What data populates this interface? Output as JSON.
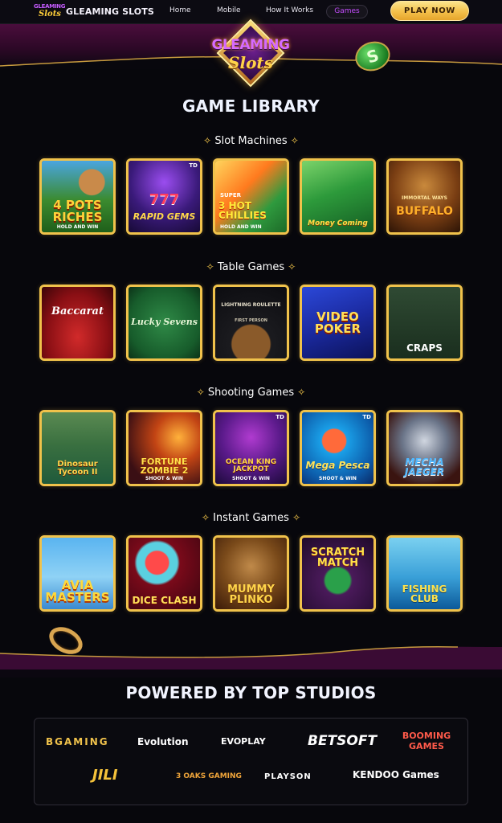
{
  "nav": {
    "brand_logo_top": "GLEAMING",
    "brand_logo_bottom": "Slots",
    "brand_name": "GLEAMING SLOTS",
    "links": [
      "Home",
      "Mobile",
      "How It Works",
      "Games"
    ],
    "active": "Games",
    "play_now": "PLAY NOW"
  },
  "hero": {
    "logo_top": "GLEAMING",
    "logo_bottom": "Slots",
    "coin_symbol": "S"
  },
  "library_title": "GAME LIBRARY",
  "categories": [
    {
      "title": "Slot Machines",
      "games": [
        {
          "label": "4 POTS RICHES",
          "sub": "HOLD AND WIN"
        },
        {
          "label": "RAPID GEMS",
          "top": "777",
          "badge": "TD"
        },
        {
          "label": "3 HOT CHILLIES",
          "top": "SUPER",
          "sub": "HOLD AND WIN"
        },
        {
          "label": "Money Coming"
        },
        {
          "label": "BUFFALO",
          "top": "IMMORTAL WAYS"
        }
      ]
    },
    {
      "title": "Table Games",
      "games": [
        {
          "label": "Baccarat"
        },
        {
          "label": "Lucky Sevens"
        },
        {
          "label": "LIGHTNING ROULETTE",
          "sub": "FIRST PERSON"
        },
        {
          "label": "VIDEO POKER"
        },
        {
          "label": "CRAPS"
        }
      ]
    },
    {
      "title": "Shooting Games",
      "games": [
        {
          "label": "Dinosaur Tycoon II"
        },
        {
          "label": "FORTUNE ZOMBIE 2",
          "sub": "SHOOT & WIN"
        },
        {
          "label": "OCEAN KING JACKPOT",
          "sub": "SHOOT & WIN",
          "badge": "TD"
        },
        {
          "label": "Mega Pesca",
          "sub": "SHOOT & WIN",
          "badge": "TD"
        },
        {
          "label": "MECHA JAEGER"
        }
      ]
    },
    {
      "title": "Instant Games",
      "games": [
        {
          "label": "AVIA MASTERS"
        },
        {
          "label": "DICE CLASH"
        },
        {
          "label": "MUMMY PLINKO"
        },
        {
          "label": "SCRATCH MATCH"
        },
        {
          "label": "FISHING CLUB"
        }
      ]
    }
  ],
  "studios_title": "POWERED BY TOP STUDIOS",
  "studios": [
    "BGAMING",
    "Evolution",
    "EVOPLAY",
    "BETSOFT",
    "BOOMING GAMES",
    "JILI",
    "3 OAKS GAMING",
    "PLAYSON",
    "KENDOO Games"
  ],
  "colors": {
    "gold": "#f0c24b",
    "accent_purple": "#c54dff",
    "bg": "#07070c"
  }
}
